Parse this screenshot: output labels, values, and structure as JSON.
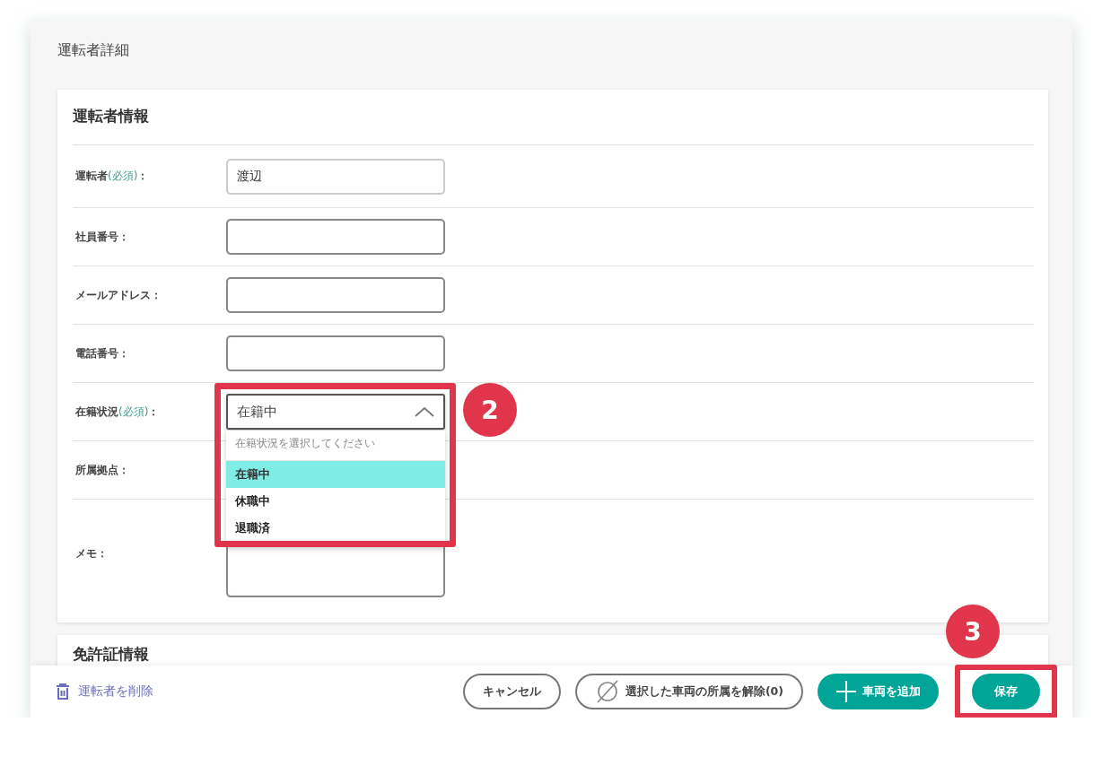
{
  "page_title": "運転者詳細",
  "sections": [
    {
      "title": "運転者情報",
      "rows": [
        {
          "kind": "text",
          "label": "運転者",
          "note": "(必須)",
          "tail": "：",
          "value": "渡辺"
        },
        {
          "kind": "text",
          "label": "社員番号",
          "tail": "："
        },
        {
          "kind": "text",
          "label": "メールアドレス",
          "tail": "："
        },
        {
          "kind": "text",
          "label": "電話番号",
          "tail": "："
        },
        {
          "kind": "select",
          "label": "在籍状況",
          "note": "(必須)",
          "tail": "：",
          "value": "在籍中",
          "expanded": true,
          "prompt": "在籍状況を選択してください",
          "options": [
            {
              "label": "在籍中",
              "selected": true
            },
            {
              "label": "休職中",
              "selected": false
            },
            {
              "label": "退職済",
              "selected": false
            }
          ]
        },
        {
          "kind": "hidden",
          "label": "所属拠点",
          "tail": "："
        },
        {
          "kind": "textarea",
          "label": "メモ",
          "tail": "："
        }
      ]
    },
    {
      "title": "免許証情報"
    }
  ],
  "footer": {
    "delete_link": "運転者を削除",
    "buttons": [
      {
        "kind": "outline",
        "label": "キャンセル"
      },
      {
        "kind": "outline-icon",
        "label": "選択した車両の所属を解除(0)"
      },
      {
        "kind": "add",
        "label": "車両を追加"
      },
      {
        "kind": "primary",
        "label": "保存"
      }
    ]
  },
  "annotations": [
    {
      "label": "2"
    },
    {
      "label": "3"
    }
  ]
}
